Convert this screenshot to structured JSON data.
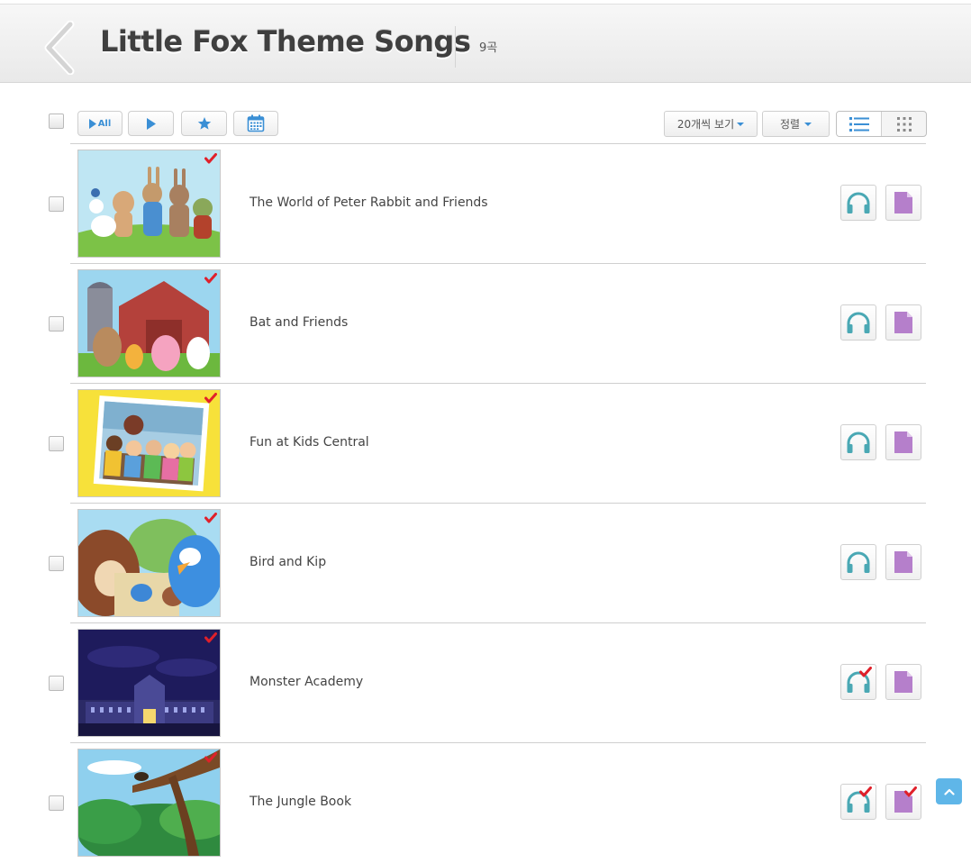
{
  "header": {
    "title": "Little Fox Theme Songs",
    "count": "9곡"
  },
  "toolbar": {
    "play_all_label": "All",
    "per_page": "20개씩 보기",
    "sort": "정렬"
  },
  "songs": [
    {
      "title": "The World of Peter Rabbit and Friends",
      "viewed": true,
      "listened": false,
      "read": false
    },
    {
      "title": "Bat and Friends",
      "viewed": true,
      "listened": false,
      "read": false
    },
    {
      "title": "Fun at Kids Central",
      "viewed": true,
      "listened": false,
      "read": false
    },
    {
      "title": "Bird and Kip",
      "viewed": true,
      "listened": false,
      "read": false
    },
    {
      "title": "Monster Academy",
      "viewed": true,
      "listened": true,
      "read": false
    },
    {
      "title": "The Jungle Book",
      "viewed": true,
      "listened": true,
      "read": true
    }
  ],
  "colors": {
    "accent_blue": "#3a8fd5",
    "headphone_teal": "#4aa8b4",
    "document_purple": "#b57fcb",
    "check_red": "#e0202a",
    "scroll_top": "#5fb6e8"
  },
  "icons": [
    "back-arrow-icon",
    "play-all-icon",
    "play-icon",
    "star-icon",
    "calendar-icon",
    "list-view-icon",
    "grid-view-icon",
    "headphones-icon",
    "document-icon",
    "checkmark-icon",
    "chevron-up-icon"
  ]
}
